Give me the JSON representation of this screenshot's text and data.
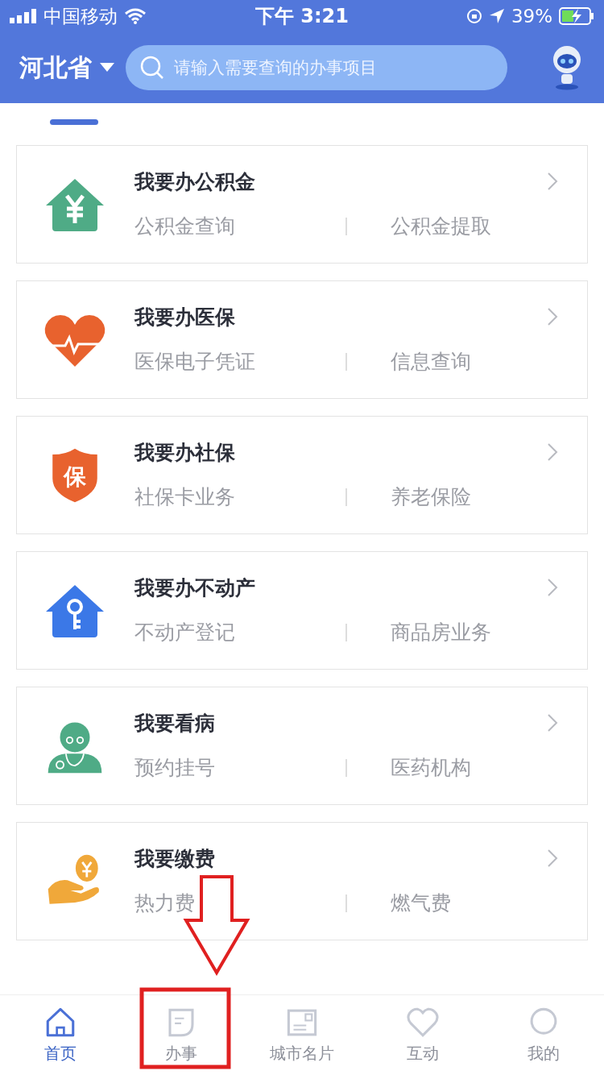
{
  "status_bar": {
    "carrier": "中国移动",
    "time": "下午 3:21",
    "battery": "39%"
  },
  "header": {
    "region": "河北省",
    "search": {
      "placeholder": "请输入需要查询的办事项目"
    }
  },
  "services": [
    {
      "kind": "fund",
      "title": "我要办公积金",
      "items": [
        "公积金查询",
        "公积金提取"
      ]
    },
    {
      "kind": "medical",
      "title": "我要办医保",
      "items": [
        "医保电子凭证",
        "信息查询"
      ]
    },
    {
      "kind": "social",
      "title": "我要办社保",
      "icon_text": "保",
      "items": [
        "社保卡业务",
        "养老保险"
      ]
    },
    {
      "kind": "estate",
      "title": "我要办不动产",
      "items": [
        "不动产登记",
        "商品房业务"
      ]
    },
    {
      "kind": "doctor",
      "title": "我要看病",
      "items": [
        "预约挂号",
        "医药机构"
      ]
    },
    {
      "kind": "payment",
      "title": "我要缴费",
      "items": [
        "热力费",
        "燃气费"
      ]
    }
  ],
  "tab_bar": [
    {
      "kind": "home",
      "label": "首页",
      "selected": true
    },
    {
      "kind": "affairs",
      "label": "办事",
      "selected": false
    },
    {
      "kind": "card",
      "label": "城市名片",
      "selected": false
    },
    {
      "kind": "interact",
      "label": "互动",
      "selected": false
    },
    {
      "kind": "mine",
      "label": "我的",
      "selected": false
    }
  ]
}
